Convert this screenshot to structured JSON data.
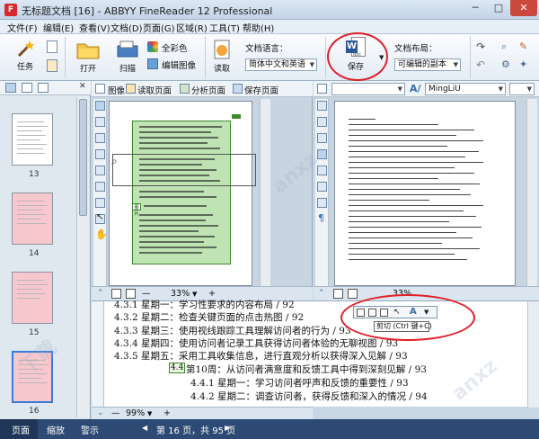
{
  "window": {
    "title": "无标题文档 [16] - ABBYY FineReader 12 Professional",
    "app_icon": "F",
    "minimize": "─",
    "maximize": "□",
    "close": "✕"
  },
  "menu": [
    {
      "label": "文件(F)"
    },
    {
      "label": "编辑(E)"
    },
    {
      "label": "查看(V)"
    },
    {
      "label": "文档(D)"
    },
    {
      "label": "页面(G)"
    },
    {
      "label": "区域(R)"
    },
    {
      "label": "工具(T)"
    },
    {
      "label": "帮助(H)"
    }
  ],
  "ribbon": {
    "task": "任务",
    "open": "打开",
    "scan": "扫描",
    "full_color": "全彩色",
    "edit_image": "编辑图像",
    "read": "读取",
    "doc_lang_label": "文档语言：",
    "doc_lang_value": "简体中文和英语",
    "save": "保存",
    "save_icon_text": "doc",
    "layout_label": "文档布局：",
    "layout_value": "可编辑的副本"
  },
  "image_toolbar": {
    "image": "图像",
    "read_page": "读取页面",
    "analyze_page": "分析页面",
    "save_page": "保存页面"
  },
  "text_toolbar": {
    "font_value": "MingLiU"
  },
  "thumbnails": [
    {
      "num": "13"
    },
    {
      "num": "14"
    },
    {
      "num": "15"
    },
    {
      "num": "16"
    }
  ],
  "zoom": {
    "image": "33%",
    "text": "33%",
    "zoom_window": "99%"
  },
  "selection_label": "图片",
  "zoom_lines": [
    {
      "num": "",
      "text": "4.3.1  星期一：学习性要求的内容布局 / 92"
    },
    {
      "num": "",
      "text": "4.3.2  星期二：检查关键页面的点击热图 / 92"
    },
    {
      "num": "",
      "text": "4.3.3  星期三：使用视线跟踪工具理解访问者的行为 / 93"
    },
    {
      "num": "",
      "text": "4.3.4  星期四：使用访问者记录工具获得访问者体验的无聊视图 / 93"
    },
    {
      "num": "",
      "text": "4.3.5  星期五：采用工具收集信息，进行直观分析以获得深入见解 / 93"
    },
    {
      "num": "4.4",
      "text": "第10周：从访问者满意度和反馈工具中得到深刻见解 / 93"
    },
    {
      "num": "",
      "text": "4.4.1  星期一：学习访问者呼声和反馈的重要性 / 93"
    },
    {
      "num": "",
      "text": "4.4.2  星期二：调查访问者，获得反馈和深入的情况 / 94"
    }
  ],
  "tooltip": "剪切 (Ctrl 键+C)",
  "statusbar": {
    "pages": "页面",
    "zoom": "缩放",
    "warnings": "警示",
    "page_info": "第 16 页，共 95 页"
  },
  "colors": {
    "titlebar": "#c3d4e7",
    "statusbar": "#2d4a74",
    "selection": "#a9d99a",
    "highlight": "#e0202a",
    "thumb_pink": "#f7c7ce"
  }
}
